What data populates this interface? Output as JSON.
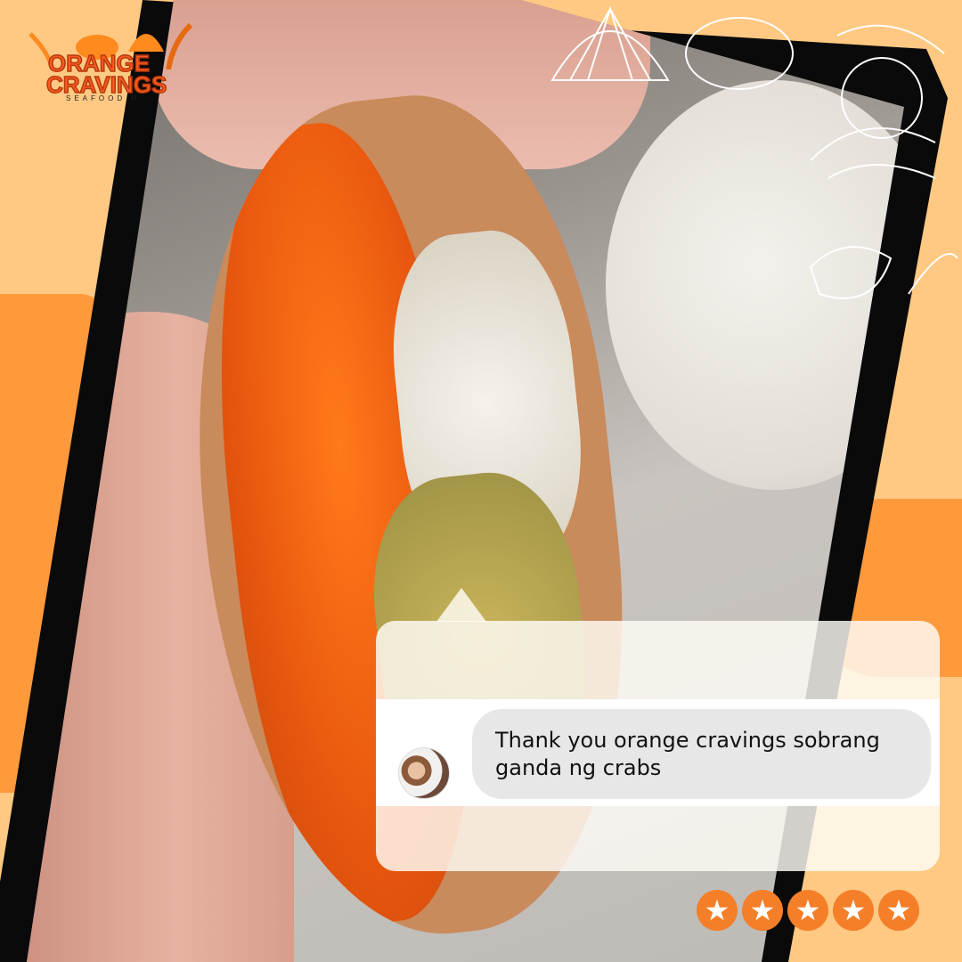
{
  "brand": {
    "name_line1": "ORANGE",
    "name_line2": "CRAVINGS",
    "tagline": "SEAFOOD H"
  },
  "review": {
    "message": "Thank you orange cravings sobrang ganda ng crabs",
    "rating": 5,
    "rating_max": 5
  },
  "colors": {
    "background": "#ffc983",
    "accent": "#f57f28",
    "bubble": "#e7e7e8"
  }
}
